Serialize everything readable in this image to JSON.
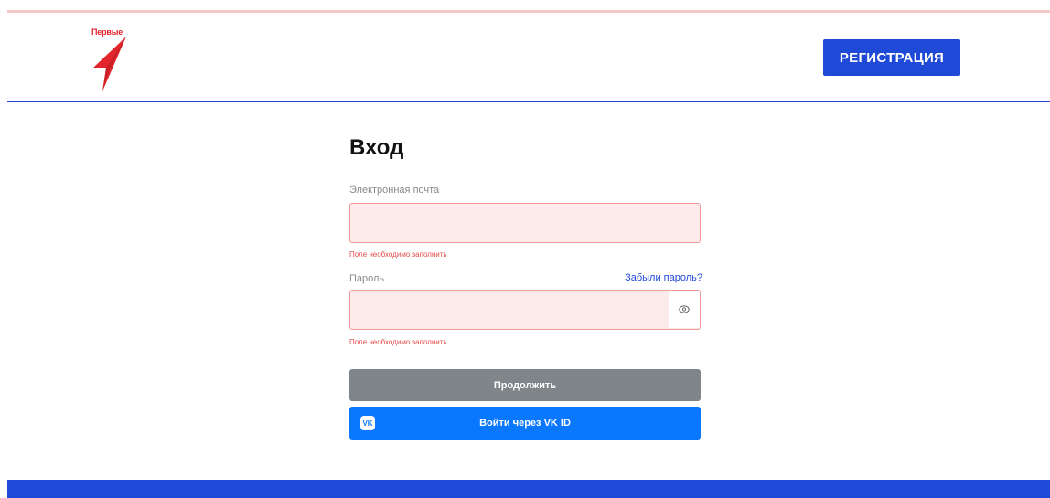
{
  "brand": {
    "logo_text": "Первые",
    "logo_icon": "red-arrow-logo-icon",
    "logo_color": "#e3262c"
  },
  "header": {
    "register_label": "РЕГИСТРАЦИЯ",
    "accent_color": "#1f4ad8"
  },
  "login": {
    "title": "Вход",
    "email": {
      "label": "Электронная почта",
      "value": "",
      "error": "Поле необходимо заполнить"
    },
    "password": {
      "label": "Пароль",
      "value": "",
      "forgot_label": "Забыли пароль?",
      "error": "Поле необходимо заполнить",
      "toggle_icon": "eye-icon"
    },
    "continue_label": "Продолжить",
    "vk_label": "Войти через VK ID",
    "vk_icon_text": "VK",
    "error_color": "#e24b47",
    "vk_color": "#0a77ff"
  }
}
